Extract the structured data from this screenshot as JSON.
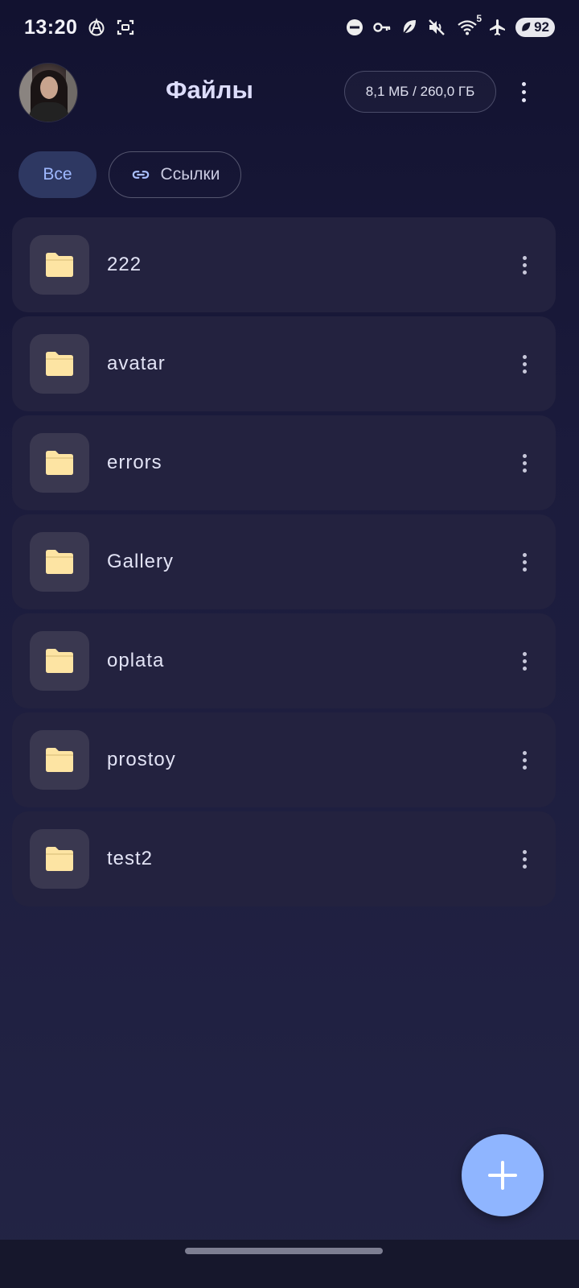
{
  "status_bar": {
    "time": "13:20",
    "battery": "92",
    "wifi_badge": "5",
    "icons": [
      "vpn-anarchy-icon",
      "screenshot-icon",
      "dnd-icon",
      "key-icon",
      "leaf-icon",
      "mute-icon",
      "wifi-icon",
      "airplane-icon",
      "battery-icon"
    ]
  },
  "header": {
    "title": "Файлы",
    "storage": "8,1 МБ / 260,0 ГБ"
  },
  "filters": {
    "all_label": "Все",
    "links_label": "Ссылки"
  },
  "files": [
    {
      "name": "222"
    },
    {
      "name": "avatar"
    },
    {
      "name": "errors"
    },
    {
      "name": "Gallery"
    },
    {
      "name": "oplata"
    },
    {
      "name": "prostoy"
    },
    {
      "name": "test2"
    }
  ],
  "colors": {
    "accent": "#8fb5ff",
    "folder": "#fde4a3",
    "row_bg": "#23223f"
  }
}
